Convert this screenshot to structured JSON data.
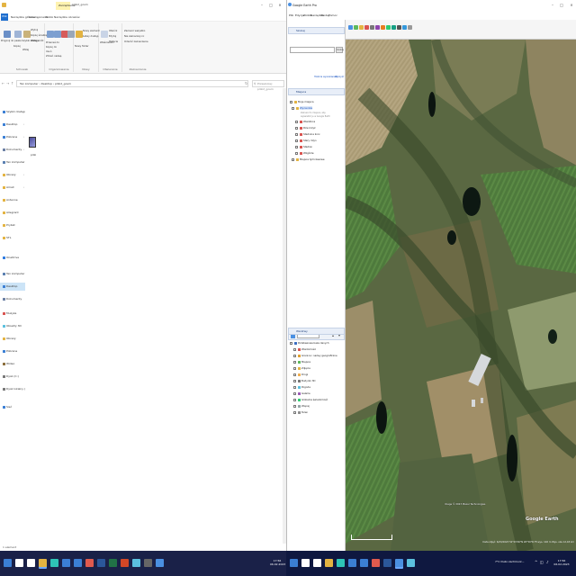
{
  "explorer": {
    "title": "pliki2_gosm",
    "ribbon_context_tab": "Zarządzanie",
    "ribbon_tabs": [
      "Plik",
      "Narzędzia główne",
      "Udostępnianie",
      "Widok",
      "Narzędzia obrazów"
    ],
    "ribbon_groups": {
      "clipboard": {
        "label": "Schowek",
        "items": [
          "Przypnij do paska Szybki dostęp",
          "Kopiuj",
          "Wklej",
          "Wytnij",
          "Kopiuj ścieżkę",
          "Wklej skrót"
        ]
      },
      "organize": {
        "label": "Organizowanie",
        "items": [
          "Przenieś do",
          "Kopiuj do",
          "Usuń",
          "Zmień nazwę"
        ]
      },
      "new": {
        "label": "Nowy",
        "items": [
          "Nowy element",
          "Łatwy dostęp",
          "Nowy folder"
        ]
      },
      "open": {
        "label": "Otwieranie",
        "items": [
          "Właściwości",
          "Otwórz",
          "Edytuj",
          "Historia"
        ]
      },
      "select": {
        "label": "Zaznaczanie",
        "items": [
          "Zaznacz wszystko",
          "Nie zaznaczaj nic",
          "Odwróć zaznaczenie"
        ]
      }
    },
    "address": {
      "path": [
        "Ten komputer",
        "Desktop",
        "pliki2_gosm"
      ],
      "search_placeholder": "Przeszukaj: pliki2_gosm"
    },
    "nav": [
      {
        "label": "Szybki dostęp",
        "pinned": false,
        "color": "#3b7fd4"
      },
      {
        "label": "Desktop",
        "pinned": true,
        "color": "#3b7fd4"
      },
      {
        "label": "Pobrane",
        "pinned": true,
        "color": "#3b7fd4"
      },
      {
        "label": "Dokumenty",
        "pinned": true,
        "color": "#6b7fa3"
      },
      {
        "label": "Ten komputer",
        "pinned": true,
        "color": "#5a7fb0"
      },
      {
        "label": "Obrazy",
        "pinned": true,
        "color": "#e3b341"
      },
      {
        "label": "Amall",
        "pinned": true,
        "color": "#e3b341"
      },
      {
        "label": "Antenne",
        "pinned": false,
        "color": "#e3b341"
      },
      {
        "label": "Allegrant",
        "pinned": false,
        "color": "#e3b341"
      },
      {
        "label": "Prybat",
        "pinned": false,
        "color": "#e3b341"
      },
      {
        "label": "STL",
        "pinned": false,
        "color": "#e3b341"
      },
      {
        "label": "OneDrive",
        "pinned": false,
        "color": "#2e7be0"
      },
      {
        "label": "Ten komputer",
        "pinned": false,
        "color": "#5a7fb0"
      },
      {
        "label": "Desktop",
        "pinned": false,
        "color": "#3b7fd4",
        "selected": true
      },
      {
        "label": "Dokumenty",
        "pinned": false,
        "color": "#6b7fa3"
      },
      {
        "label": "Muzyka",
        "pinned": false,
        "color": "#d9534f"
      },
      {
        "label": "Obiekty 3D",
        "pinned": false,
        "color": "#5bc0de"
      },
      {
        "label": "Obrazy",
        "pinned": false,
        "color": "#e3b341"
      },
      {
        "label": "Pobrane",
        "pinned": false,
        "color": "#3b7fd4"
      },
      {
        "label": "Wideo",
        "pinned": false,
        "color": "#8a6d3b"
      },
      {
        "label": "Dysk (C:)",
        "pinned": false,
        "color": "#777777"
      },
      {
        "label": "Dysk lokalny (D:)",
        "pinned": false,
        "color": "#777777"
      },
      {
        "label": "Sieć",
        "pinned": false,
        "color": "#3b7fd4"
      }
    ],
    "file": {
      "name": "pliki"
    },
    "status": "1 element"
  },
  "earth": {
    "title": "Google Earth Pro",
    "menu": [
      "Plik",
      "Edycja",
      "Widok",
      "Narzędzia",
      "Dodaj",
      "Pomoc"
    ],
    "search": {
      "header": "Szukaj",
      "go_label": "Szukaj",
      "links": [
        "Historia wyszukiwania",
        "Wyczyść"
      ]
    },
    "places": {
      "header": "Miejsca",
      "items": [
        {
          "label": "Moje miejsca",
          "kind": "folder"
        },
        {
          "label": "Wycieczka",
          "kind": "folder",
          "highlight": true
        },
        {
          "label": "Wierzbica",
          "kind": "placemark"
        },
        {
          "label": "Pole krzyż",
          "kind": "placemark"
        },
        {
          "label": "Stadnina koni",
          "kind": "placemark"
        },
        {
          "label": "Stary młyn",
          "kind": "placemark"
        },
        {
          "label": "Stadion",
          "kind": "placemark"
        },
        {
          "label": "Wzgórze",
          "kind": "placemark"
        },
        {
          "label": "Miejsca tymczasowe",
          "kind": "folder"
        }
      ],
      "note": "Zaznacz to miejsce, aby wyświetlić je w Google Earth"
    },
    "layers": {
      "header": "Warstwy",
      "items": [
        {
          "label": "Podstawowa baza danych",
          "color": "#3b6ec2"
        },
        {
          "label": "Wiadomości",
          "color": "#d9534f"
        },
        {
          "label": "Granice i nazwy geograficzne",
          "color": "#e0a030"
        },
        {
          "label": "Miejsca",
          "color": "#5cb85c"
        },
        {
          "label": "Zdjęcia",
          "color": "#e3b341"
        },
        {
          "label": "Drogi",
          "color": "#f0ad4e"
        },
        {
          "label": "Budynki 3D",
          "color": "#777777"
        },
        {
          "label": "Pogoda",
          "color": "#5bc0de"
        },
        {
          "label": "Galerie",
          "color": "#9b59b6"
        },
        {
          "label": "Globalna świadomość",
          "color": "#2ecc71"
        },
        {
          "label": "Więcej",
          "color": "#95a5a6"
        },
        {
          "label": "Teren",
          "color": "#8e8e8e"
        }
      ]
    },
    "map": {
      "logo": "Google Earth",
      "attribution": "Image © 2023 Maxar Technologies",
      "status": "Data zdjęć: 6/23/2023   52°03'46\"N  20°50'51\"E  wys. 102 m   Wys. oka 12,18 km"
    }
  },
  "taskbar": {
    "left": {
      "time": "17:56",
      "date": "06.02.2023",
      "icons": [
        {
          "name": "windows-start-icon",
          "color": "#3b7fd4"
        },
        {
          "name": "search-icon",
          "color": "#ffffff"
        },
        {
          "name": "task-view-icon",
          "color": "#ffffff"
        },
        {
          "name": "explorer-icon",
          "color": "#e3b341",
          "active": true
        },
        {
          "name": "edge-icon",
          "color": "#2ec4b6"
        },
        {
          "name": "store-icon",
          "color": "#3b7fd4"
        },
        {
          "name": "mail-icon",
          "color": "#3b7fd4"
        },
        {
          "name": "chrome-icon",
          "color": "#e05a4e"
        },
        {
          "name": "word-icon",
          "color": "#2b579a"
        },
        {
          "name": "excel-icon",
          "color": "#217346"
        },
        {
          "name": "powerpoint-icon",
          "color": "#d24726"
        },
        {
          "name": "photos-icon",
          "color": "#5bc0de"
        },
        {
          "name": "calculator-icon",
          "color": "#666666"
        },
        {
          "name": "google-earth-icon",
          "color": "#4a90e2"
        }
      ]
    },
    "right": {
      "time": "17:56",
      "date": "06.02.2023",
      "weather": "7°C Dużo zachmurz...",
      "icons": [
        {
          "name": "windows-start-icon",
          "color": "#3b7fd4"
        },
        {
          "name": "search-icon",
          "color": "#ffffff"
        },
        {
          "name": "task-view-icon",
          "color": "#ffffff"
        },
        {
          "name": "explorer-icon",
          "color": "#e3b341"
        },
        {
          "name": "edge-icon",
          "color": "#2ec4b6"
        },
        {
          "name": "store-icon",
          "color": "#3b7fd4"
        },
        {
          "name": "mail-icon",
          "color": "#3b7fd4"
        },
        {
          "name": "chrome-icon",
          "color": "#e05a4e"
        },
        {
          "name": "word-icon",
          "color": "#2b579a"
        },
        {
          "name": "google-earth-icon",
          "color": "#4a90e2",
          "active": true
        },
        {
          "name": "photos-icon",
          "color": "#5bc0de"
        }
      ]
    }
  }
}
